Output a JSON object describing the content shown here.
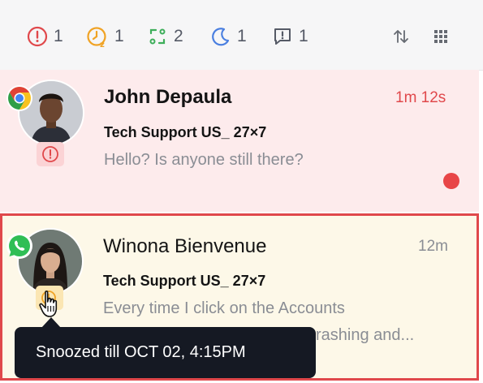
{
  "filters": [
    {
      "icon": "alert-circle-icon",
      "count": "1",
      "color": "#e0484b"
    },
    {
      "icon": "snooze-clock-icon",
      "count": "1",
      "color": "#f0a325"
    },
    {
      "icon": "transfer-icon",
      "count": "2",
      "color": "#3dae5a"
    },
    {
      "icon": "moon-icon",
      "count": "1",
      "color": "#4a7fe0"
    },
    {
      "icon": "chat-alert-icon",
      "count": "1",
      "color": "#555a66"
    }
  ],
  "toolbar": {
    "sort_icon": "sort-arrows-icon",
    "grid_icon": "grid-dots-icon"
  },
  "conversations": [
    {
      "name": "John Depaula",
      "time": "1m 12s",
      "queue": "Tech Support US_ 27×7",
      "message": "Hello? Is anyone still there?",
      "source_icon": "chrome-icon",
      "status_icon": "alert-circle-icon",
      "unread": true
    },
    {
      "name": "Winona Bienvenue",
      "time": "12m",
      "queue": "Tech Support US_ 27×7",
      "message_line1": "Every time I click on the Accounts",
      "message_line2": "rashing and...",
      "source_icon": "whatsapp-icon",
      "status_icon": "snooze-clock-icon",
      "selected": true
    }
  ],
  "tooltip": {
    "text": "Snoozed till OCT 02, 4:15PM"
  },
  "colors": {
    "urgent": "#e0484b",
    "snooze": "#f0a325",
    "urgent_bg": "#fdebec",
    "snooze_bg": "#fdf8e8",
    "tooltip_bg": "#151923"
  }
}
